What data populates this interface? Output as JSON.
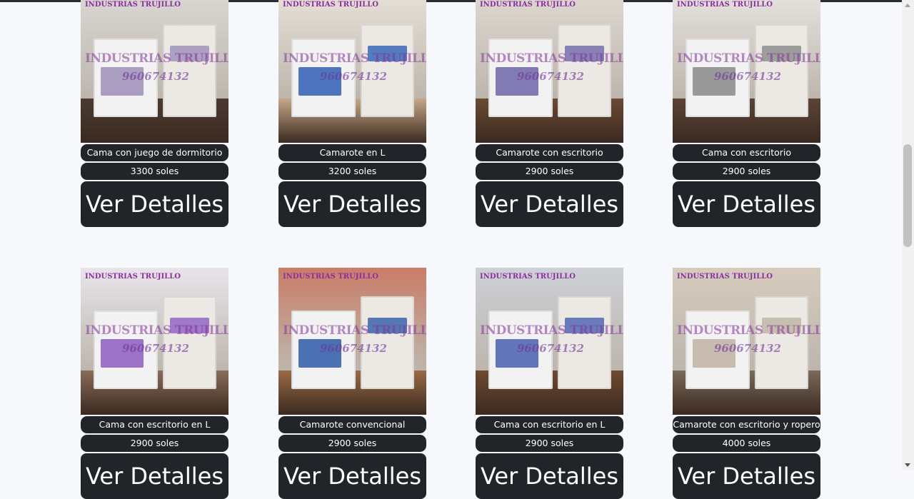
{
  "brand": {
    "watermark_small": "INDUSTRIAS TRUJILLO",
    "watermark_big": "INDUSTRIAS TRUJILLO",
    "phone": "960674132"
  },
  "products": [
    {
      "name": "Cama con juego de dormitorio",
      "price": "3300 soles",
      "button": "Ver Detalles",
      "palette": {
        "wall": "#d9d6d2",
        "floor": "#4a3a2f",
        "accent": "#9d8fb8"
      }
    },
    {
      "name": "Camarote en L",
      "price": "3200 soles",
      "button": "Ver Detalles",
      "palette": {
        "wall": "#e6dfd6",
        "floor": "#c7a888",
        "accent": "#2f5fb5"
      }
    },
    {
      "name": "Camarote con escritorio",
      "price": "2900 soles",
      "button": "Ver Detalles",
      "palette": {
        "wall": "#dcd7cf",
        "floor": "#6b4a33",
        "accent": "#6f66a8"
      }
    },
    {
      "name": "Cama con escritorio",
      "price": "2900 soles",
      "button": "Ver Detalles",
      "palette": {
        "wall": "#e4e1dc",
        "floor": "#5c4436",
        "accent": "#8a8a8a"
      }
    },
    {
      "name": "Cama con escritorio en L",
      "price": "2900 soles",
      "button": "Ver Detalles",
      "palette": {
        "wall": "#e8e4ea",
        "floor": "#8a6c59",
        "accent": "#8e5cc2"
      }
    },
    {
      "name": "Camarote convencional",
      "price": "2900 soles",
      "button": "Ver Detalles",
      "palette": {
        "wall": "#c97d68",
        "floor": "#9a6a45",
        "accent": "#2f5aa8"
      }
    },
    {
      "name": "Cama con escritorio en L",
      "price": "2900 soles",
      "button": "Ver Detalles",
      "palette": {
        "wall": "#cdd0d6",
        "floor": "#6e4a30",
        "accent": "#4a5fb0"
      }
    },
    {
      "name": "Camarote con escritorio y ropero",
      "price": "4000 soles",
      "button": "Ver Detalles",
      "palette": {
        "wall": "#d6cbbd",
        "floor": "#7a6a5b",
        "accent": "#bfb3a3"
      }
    }
  ]
}
